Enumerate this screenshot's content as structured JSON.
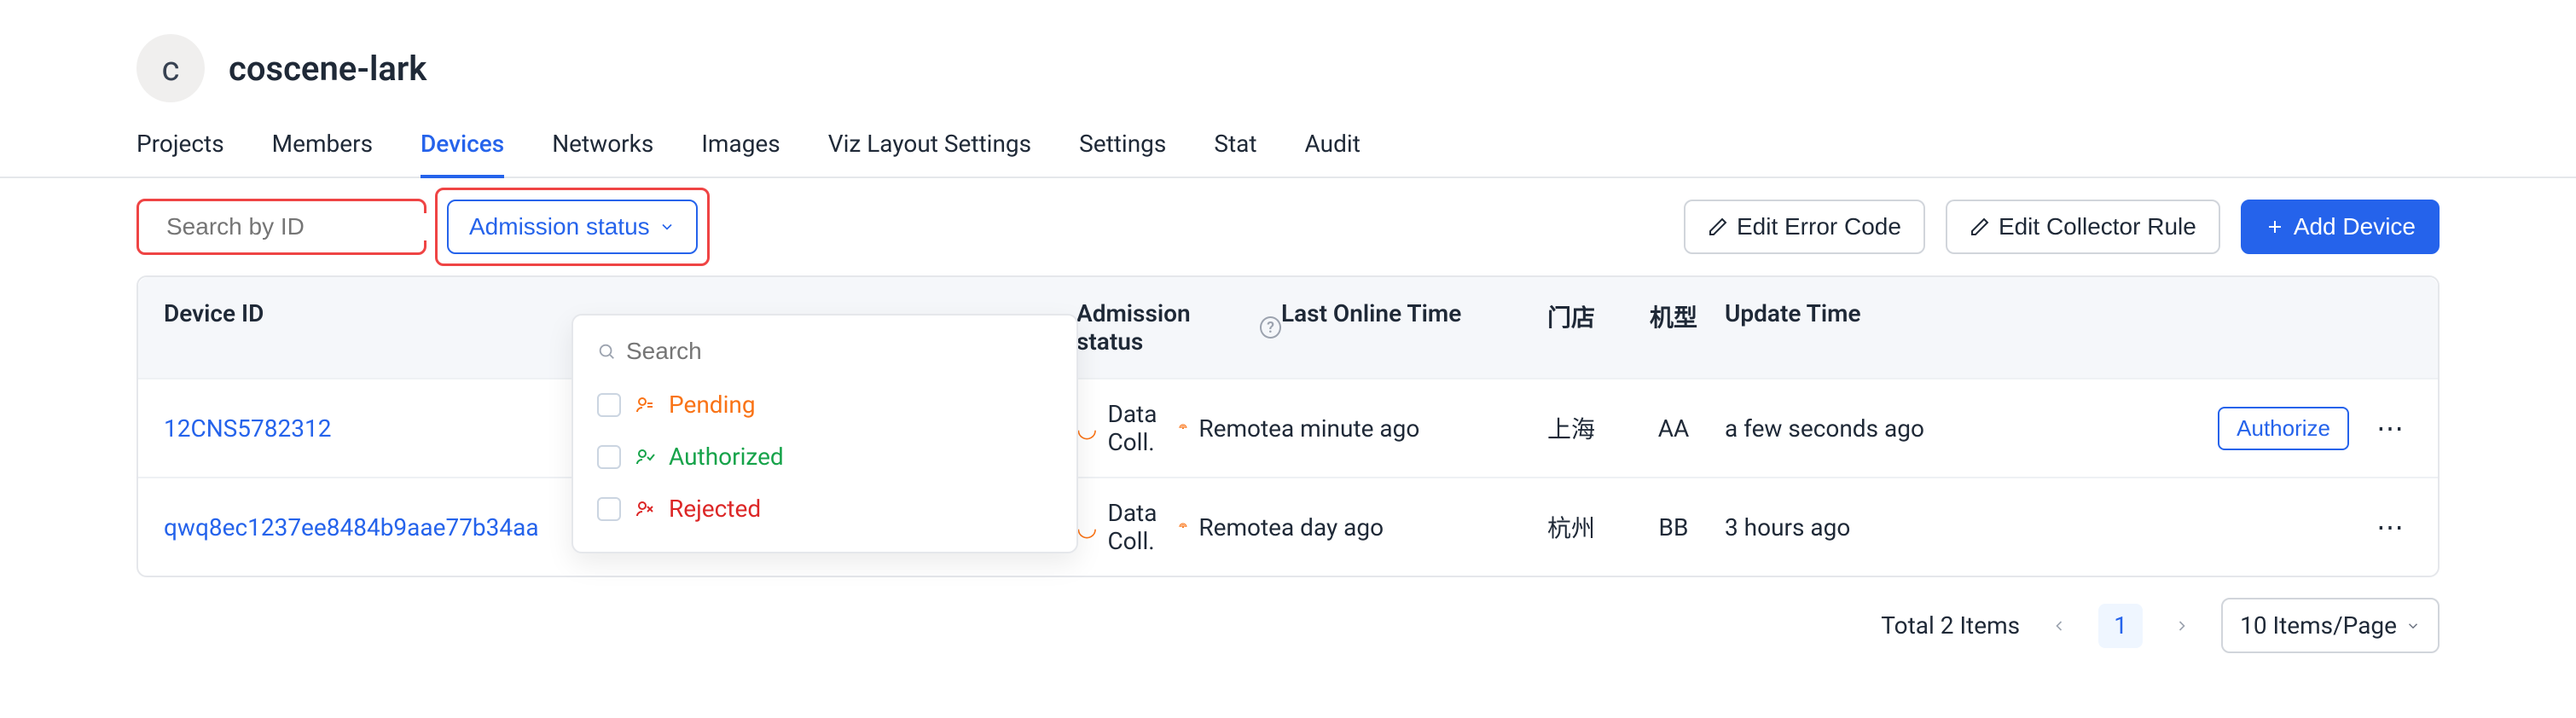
{
  "header": {
    "avatar_letter": "c",
    "org_name": "coscene-lark"
  },
  "tabs": [
    "Projects",
    "Members",
    "Devices",
    "Networks",
    "Images",
    "Viz Layout Settings",
    "Settings",
    "Stat",
    "Audit"
  ],
  "active_tab": "Devices",
  "search": {
    "placeholder": "Search by ID",
    "value": ""
  },
  "filter": {
    "label": "Admission status",
    "search_placeholder": "Search",
    "options": [
      {
        "key": "pending",
        "label": "Pending"
      },
      {
        "key": "authorized",
        "label": "Authorized"
      },
      {
        "key": "rejected",
        "label": "Rejected"
      }
    ]
  },
  "actions": {
    "edit_error": "Edit Error Code",
    "edit_collector": "Edit Collector Rule",
    "add_device": "Add Device"
  },
  "table": {
    "columns": {
      "device_id": "Device ID",
      "admission": "Admission status",
      "last_online": "Last Online Time",
      "store": "门店",
      "model": "机型",
      "update": "Update Time"
    },
    "rows": [
      {
        "device_id": "12CNS5782312",
        "data_coll": "Data Coll.",
        "remote": "Remote",
        "last_online": "a minute ago",
        "store": "上海",
        "model": "AA",
        "update": "a few seconds ago",
        "authorize": "Authorize"
      },
      {
        "device_id": "qwq8ec1237ee8484b9aae77b34aa",
        "data_coll": "Data Coll.",
        "remote": "Remote",
        "last_online": "a day ago",
        "store": "杭州",
        "model": "BB",
        "update": "3 hours ago",
        "authorize": null
      }
    ]
  },
  "pagination": {
    "total_label": "Total 2 Items",
    "current": "1",
    "page_size_label": "10 Items/Page"
  }
}
